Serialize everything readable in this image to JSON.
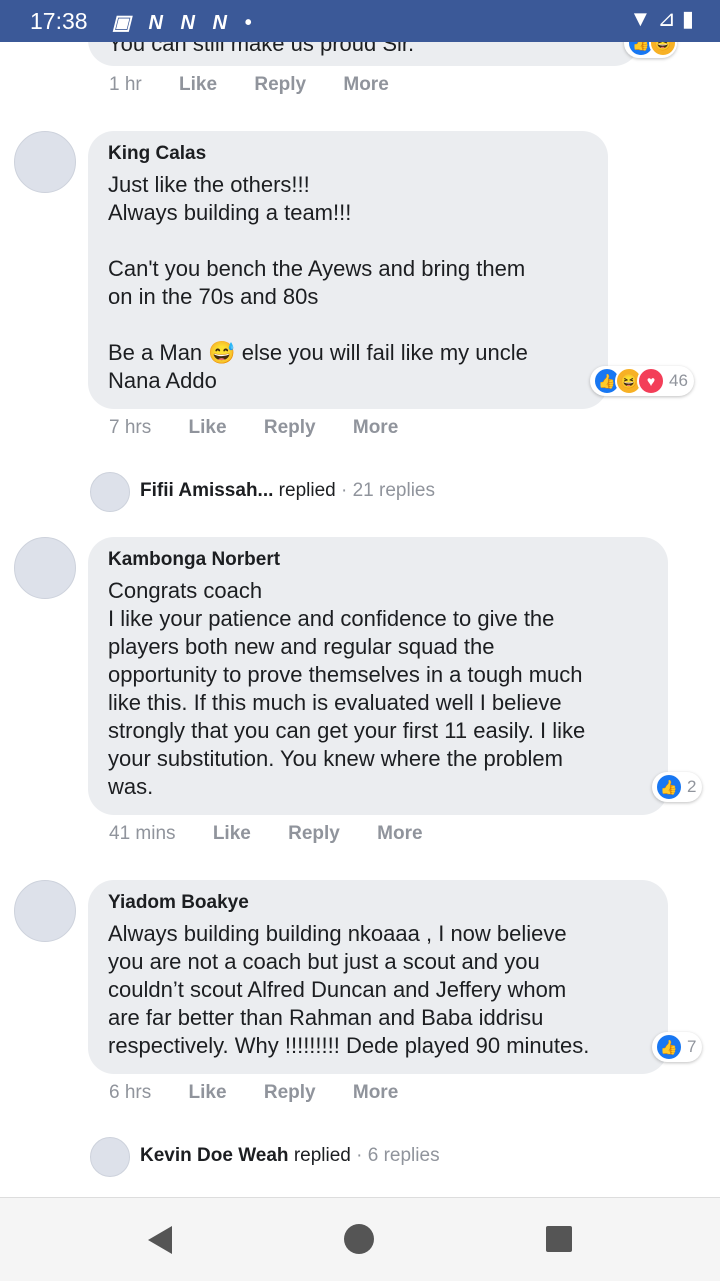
{
  "status_bar": {
    "time": "17:38",
    "icons": "▣ N N N •",
    "right": "▼ ⊿ ▮"
  },
  "top_partial": {
    "text": "You can still make us proud Sir.",
    "time": "1 hr",
    "like": "Like",
    "reply": "Reply",
    "more": "More"
  },
  "comments": [
    {
      "author": "King Calas",
      "text": "Just like the others!!!\nAlways building a team!!!\n\nCan't you bench the Ayews and bring them\non in the 70s and 80s\n\nBe a Man 😅 else you will fail like my uncle\nNana Addo",
      "reaction_count": "46",
      "time": "7 hrs",
      "like": "Like",
      "reply": "Reply",
      "more": "More",
      "reply_summary": {
        "name": "Fifii Amissah...",
        "action": "replied",
        "count": "· 21 replies"
      }
    },
    {
      "author": "Kambonga Norbert",
      "text": "Congrats coach\nI like your patience and confidence to give the\nplayers both new and regular squad the\nopportunity to prove themselves in a tough much\nlike this. If this much is evaluated well I believe\nstrongly that you can get your first 11 easily. I like\nyour substitution. You knew where the problem\nwas.",
      "reaction_count": "2",
      "time": "41 mins",
      "like": "Like",
      "reply": "Reply",
      "more": "More"
    },
    {
      "author": "Yiadom Boakye",
      "text": "Always building building nkoaaa , I now believe\nyou are not a coach but just a scout and you\ncouldn’t scout Alfred Duncan and Jeffery whom\nare far better than Rahman and Baba iddrisu\nrespectively. Why !!!!!!!!! Dede played 90 minutes.",
      "reaction_count": "7",
      "time": "6 hrs",
      "like": "Like",
      "reply": "Reply",
      "more": "More",
      "reply_summary": {
        "name": "Kevin Doe Weah",
        "action": "replied",
        "count": "· 6 replies"
      }
    }
  ],
  "icons": {
    "like": "like-icon",
    "haha": "haha-icon",
    "love": "love-icon"
  },
  "colors": {
    "status_bar": "#3b5998",
    "bubble": "#ebedf0",
    "like": "#1877f2"
  }
}
